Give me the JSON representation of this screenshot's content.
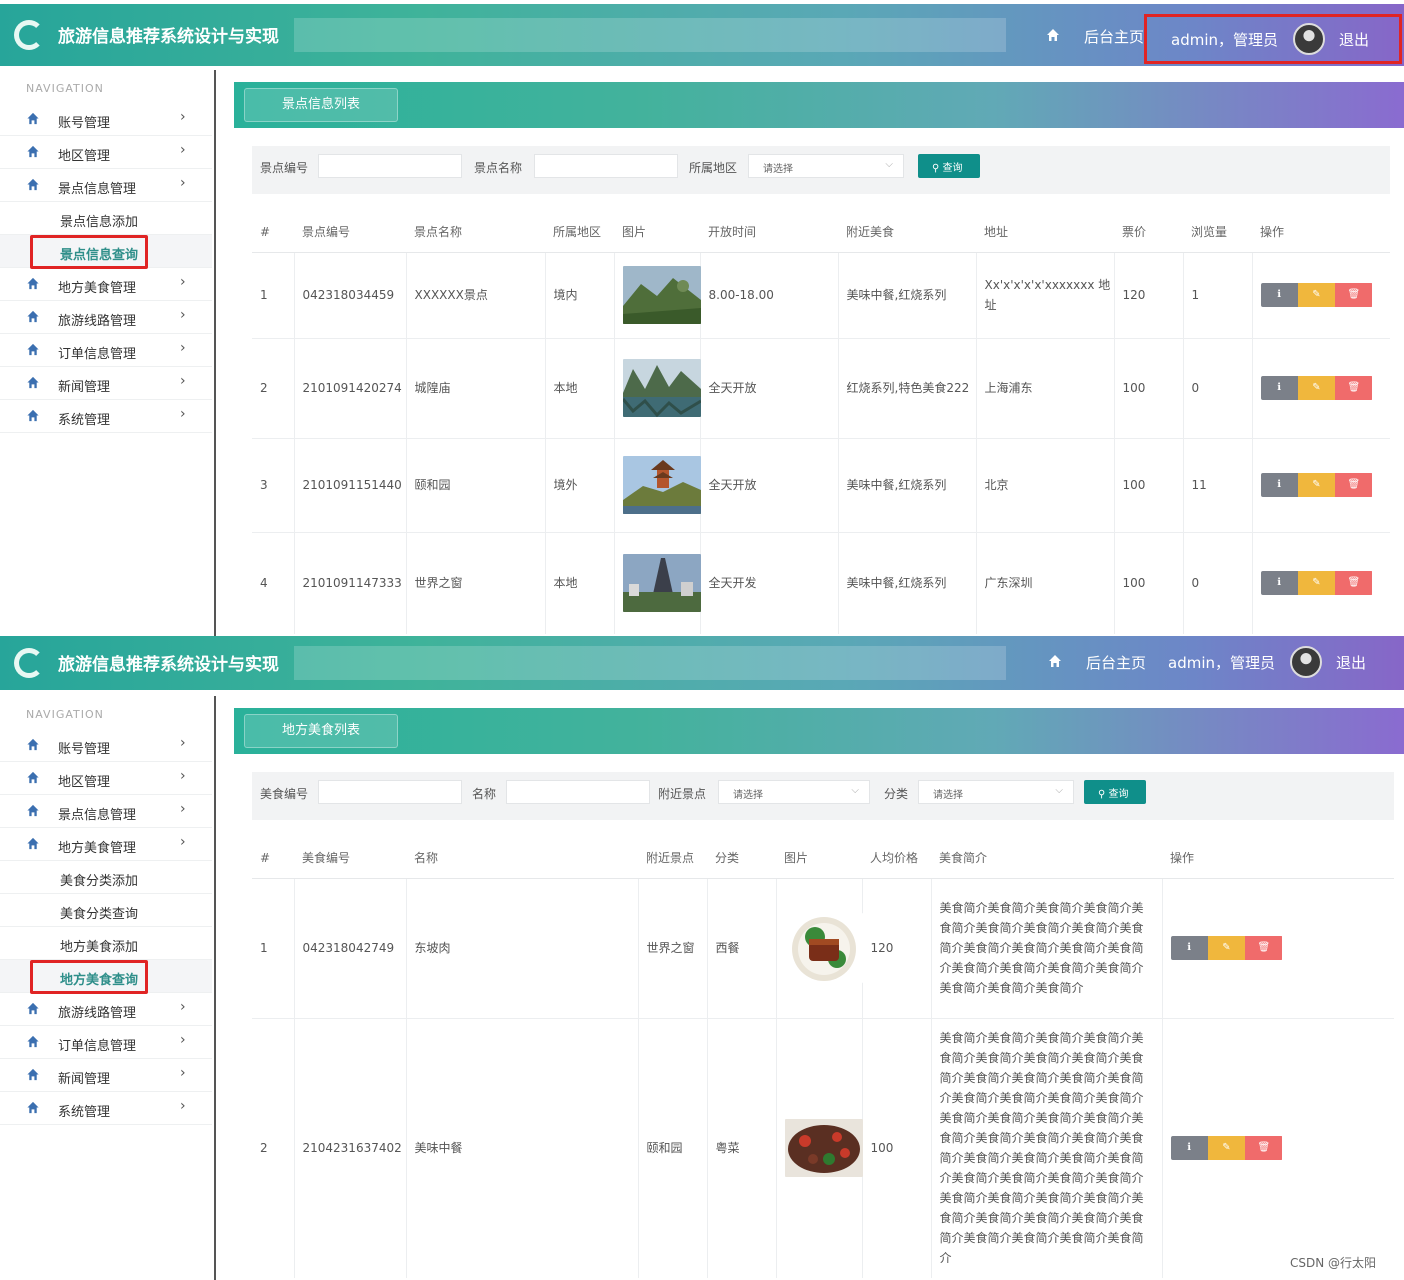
{
  "brand_title": "旅游信息推荐系统设计与实现",
  "top_nav": {
    "home": "后台主页",
    "user": "admin，管理员",
    "logout": "退出"
  },
  "nav_heading": "NAVIGATION",
  "panel1": {
    "nav_items": [
      {
        "label": "账号管理",
        "type": "group"
      },
      {
        "label": "地区管理",
        "type": "group"
      },
      {
        "label": "景点信息管理",
        "type": "group"
      },
      {
        "label": "景点信息添加",
        "type": "sub"
      },
      {
        "label": "景点信息查询",
        "type": "sub",
        "active": true
      },
      {
        "label": "地方美食管理",
        "type": "group"
      },
      {
        "label": "旅游线路管理",
        "type": "group"
      },
      {
        "label": "订单信息管理",
        "type": "group"
      },
      {
        "label": "新闻管理",
        "type": "group"
      },
      {
        "label": "系统管理",
        "type": "group"
      }
    ],
    "header_title": "景点信息列表",
    "search": {
      "label1": "景点编号",
      "label2": "景点名称",
      "label3": "所属地区",
      "select_placeholder": "请选择",
      "button": "查询"
    },
    "columns": [
      "#",
      "景点编号",
      "景点名称",
      "所属地区",
      "图片",
      "开放时间",
      "附近美食",
      "地址",
      "票价",
      "浏览量",
      "操作"
    ],
    "rows": [
      {
        "no": "1",
        "code": "042318034459",
        "name": "XXXXXX景点",
        "region": "境内",
        "img": "mountain",
        "open": "8.00-18.00",
        "food": "美味中餐,红烧系列",
        "addr": "Xx'x'x'x'x'xxxxxxx 地址",
        "price": "120",
        "views": "1"
      },
      {
        "no": "2",
        "code": "2101091420274",
        "name": "城隍庙",
        "region": "本地",
        "img": "lake",
        "open": "全天开放",
        "food": "红烧系列,特色美食222",
        "addr": "上海浦东",
        "price": "100",
        "views": "0"
      },
      {
        "no": "3",
        "code": "2101091151440",
        "name": "颐和园",
        "region": "境外",
        "img": "palace",
        "open": "全天开放",
        "food": "美味中餐,红烧系列",
        "addr": "北京",
        "price": "100",
        "views": "11"
      },
      {
        "no": "4",
        "code": "2101091147333",
        "name": "世界之窗",
        "region": "本地",
        "img": "tower",
        "open": "全天开发",
        "food": "美味中餐,红烧系列",
        "addr": "广东深圳",
        "price": "100",
        "views": "0"
      }
    ]
  },
  "panel2": {
    "nav_items": [
      {
        "label": "账号管理",
        "type": "group"
      },
      {
        "label": "地区管理",
        "type": "group"
      },
      {
        "label": "景点信息管理",
        "type": "group"
      },
      {
        "label": "地方美食管理",
        "type": "group"
      },
      {
        "label": "美食分类添加",
        "type": "sub"
      },
      {
        "label": "美食分类查询",
        "type": "sub"
      },
      {
        "label": "地方美食添加",
        "type": "sub"
      },
      {
        "label": "地方美食查询",
        "type": "sub",
        "active": true
      },
      {
        "label": "旅游线路管理",
        "type": "group"
      },
      {
        "label": "订单信息管理",
        "type": "group"
      },
      {
        "label": "新闻管理",
        "type": "group"
      },
      {
        "label": "系统管理",
        "type": "group"
      }
    ],
    "header_title": "地方美食列表",
    "search": {
      "label1": "美食编号",
      "label2": "名称",
      "label3": "附近景点",
      "label4": "分类",
      "select_placeholder": "请选择",
      "button": "查询"
    },
    "columns": [
      "#",
      "美食编号",
      "名称",
      "附近景点",
      "分类",
      "图片",
      "人均价格",
      "美食简介",
      "操作"
    ],
    "rows": [
      {
        "no": "1",
        "code": "042318042749",
        "name": "东坡肉",
        "spot": "世界之窗",
        "category": "西餐",
        "img": "pork",
        "price": "120",
        "intro": "美食简介美食简介美食简介美食简介美食简介美食简介美食简介美食简介美食简介美食简介美食简介美食简介美食简介美食简介美食简介美食简介美食简介美食简介美食简介美食简介"
      },
      {
        "no": "2",
        "code": "2104231637402",
        "name": "美味中餐",
        "spot": "颐和园",
        "category": "粤菜",
        "img": "stirfry",
        "price": "100",
        "intro": "美食简介美食简介美食简介美食简介美食简介美食简介美食简介美食简介美食简介美食简介美食简介美食简介美食简介美食简介美食简介美食简介美食简介美食简介美食简介美食简介美食简介美食简介美食简介美食简介美食简介美食简介美食简介美食简介美食简介美食简介美食简介美食简介美食简介美食简介美食简介美食简介美食简介美食简介美食简介美食简介美食简介美食简介美食简介美食简介美食简介美食简介美食简介"
      }
    ]
  },
  "watermark": "CSDN @行太阳",
  "colors": {
    "accent": "#0f8f8a",
    "highlight_border": "#e02424",
    "edit": "#f0b73d",
    "delete": "#f06b6b",
    "view": "#7b8089"
  }
}
